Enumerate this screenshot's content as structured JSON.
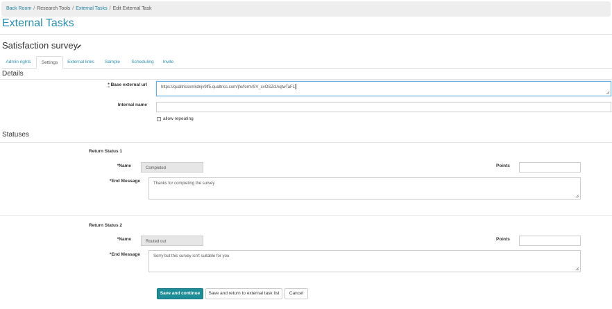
{
  "breadcrumb": [
    {
      "label": "Back Room",
      "link": true
    },
    {
      "label": "Research Tools",
      "link": false
    },
    {
      "label": "External Tasks",
      "link": true
    },
    {
      "label": "Edit External Task",
      "link": false
    }
  ],
  "breadcrumb_separator": "/",
  "page_title": "External Tasks",
  "task_title": "Satisfaction survey",
  "tabs": [
    "Admin rights",
    "Settings",
    "External links",
    "Sample",
    "Scheduling",
    "Invite"
  ],
  "active_tab": "Settings",
  "details": {
    "heading": "Details",
    "base_url_label": "Base external url",
    "base_url_value": "https://qualtricsxmkdnjv9lf5.qualtrics.com/jfe/form/SV_cvOSZclAqtwTaFL",
    "internal_name_label": "Internal name",
    "internal_name_value": "",
    "allow_repeating_label": "allow repeating"
  },
  "statuses": {
    "heading": "Statuses",
    "items": [
      {
        "title": "Return Status 1",
        "name_label": "*Name",
        "name_value": "Completed",
        "points_label": "Points",
        "points_value": "",
        "end_message_label": "*End Message",
        "end_message_value": "Thanks for completing the survey"
      },
      {
        "title": "Return Status 2",
        "name_label": "*Name",
        "name_value": "Routed out",
        "points_label": "Points",
        "points_value": "",
        "end_message_label": "*End Message",
        "end_message_value": "Sorry but this survey isn't suitable for you"
      }
    ]
  },
  "buttons": {
    "save_continue": "Save and continue",
    "save_return": "Save and return to external task list",
    "cancel": "Cancel"
  },
  "colors": {
    "accent": "#2a8fb3",
    "primary_button": "#1e8d97"
  },
  "icons": {
    "edit_title": "pencil-icon",
    "resize": "resize-grip-icon"
  }
}
